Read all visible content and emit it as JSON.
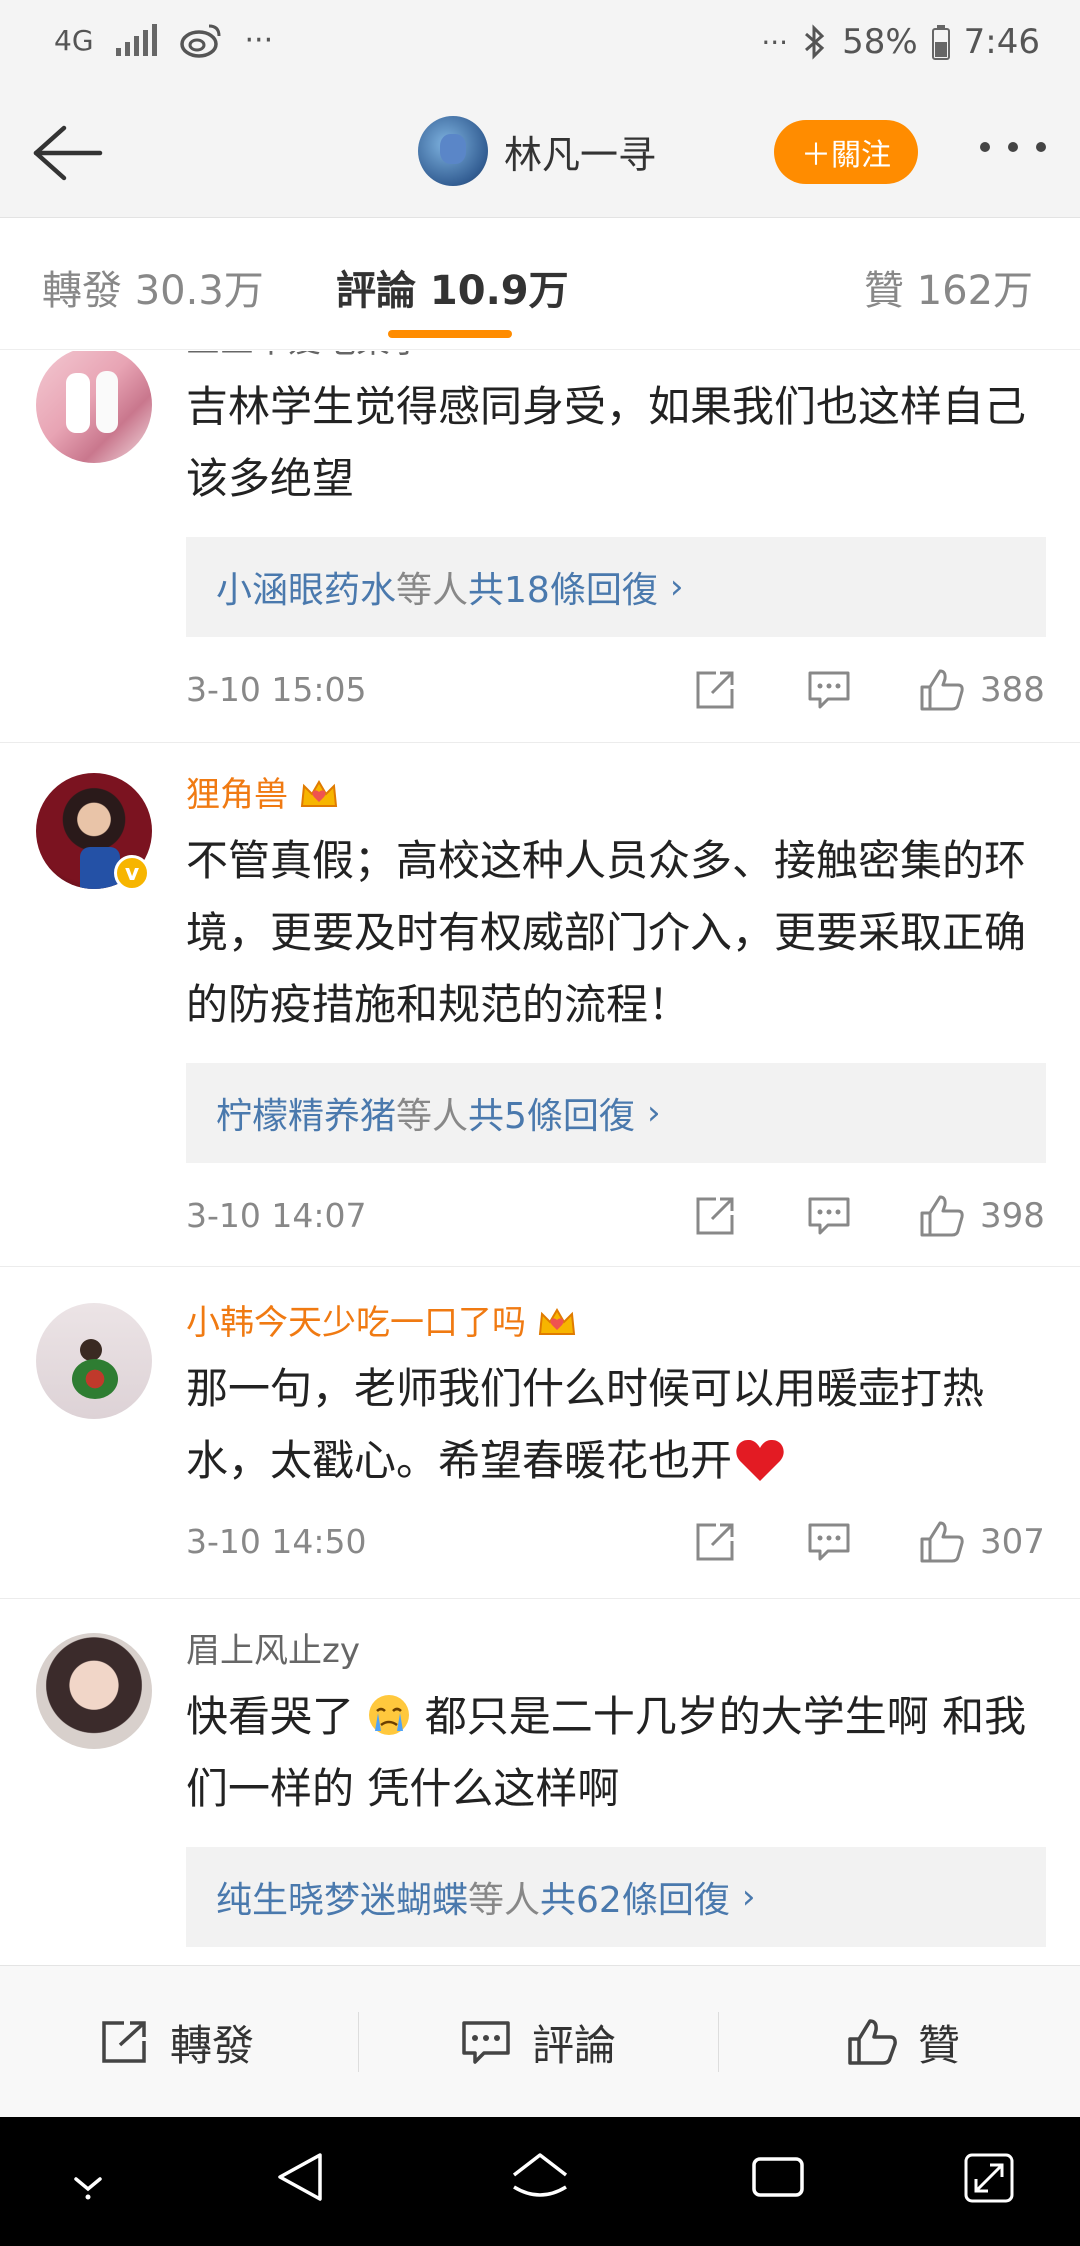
{
  "status_bar": {
    "network": "4G",
    "more": "···",
    "more_right": "···",
    "battery": "58%",
    "time": "7:46"
  },
  "header": {
    "author": "林凡一寻",
    "follow_label": "＋關注"
  },
  "tabs": [
    {
      "label": "轉發 30.3万",
      "active": false
    },
    {
      "label": "評論 10.9万",
      "active": true
    },
    {
      "label": "贊 162万",
      "active": false
    }
  ],
  "comments": [
    {
      "name": "三三不爱吃栗子",
      "text": "吉林学生觉得感同身受，如果我们也这样自己该多绝望",
      "reply_names": "小涵眼药水",
      "reply_mid": "等人 ",
      "reply_count": "共18條回復",
      "time": "3-10 15:05",
      "likes": "388"
    },
    {
      "name": "狸角兽",
      "text": "不管真假；高校这种人员众多、接触密集的环境，更要及时有权威部门介入，更要采取正确的防疫措施和规范的流程！",
      "reply_names": "柠檬精养猪",
      "reply_mid": "等人 ",
      "reply_count": "共5條回復",
      "time": "3-10 14:07",
      "likes": "398"
    },
    {
      "name": "小韩今天少吃一口了吗",
      "text": "那一句，老师我们什么时候可以用暖壶打热水，太戳心。希望春暖花也开",
      "time": "3-10 14:50",
      "likes": "307"
    },
    {
      "name": "眉上风止zy",
      "text_a": "快看哭了",
      "text_b": "都只是二十几岁的大学生啊 和我们一样的 凭什么这样啊",
      "reply_names": "纯生晓梦迷蝴蝶",
      "reply_mid": "等人 ",
      "reply_count": "共62條回復"
    }
  ],
  "bottom_bar": {
    "repost": "轉發",
    "comment": "評論",
    "like": "贊"
  },
  "colors": {
    "accent": "#ff8c00",
    "link": "#4a79ad",
    "vip_name": "#f07a12"
  }
}
